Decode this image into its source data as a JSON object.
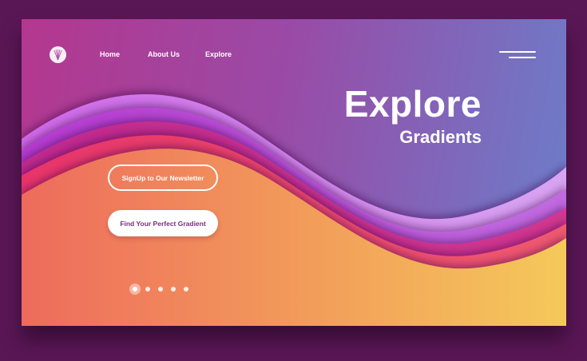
{
  "nav": {
    "items": [
      {
        "label": "Home"
      },
      {
        "label": "About Us"
      },
      {
        "label": "Explore"
      }
    ]
  },
  "hero": {
    "title": "Explore",
    "subtitle": "Gradients"
  },
  "buttons": {
    "newsletter": "SignUp to Our Newsletter",
    "find_gradient": "Find Your Perfect Gradient"
  },
  "carousel": {
    "slide_count": 5,
    "active_index": 0
  },
  "colors": {
    "outer_background": "#5a1756",
    "accent_purple": "#b4378e",
    "accent_blue": "#6a7fcb",
    "accent_orange": "#f07a5e",
    "accent_yellow": "#f4c65a",
    "button_text": "#7a2c7e"
  },
  "icons": {
    "logo": "fan-logo-icon",
    "menu": "hamburger-menu-icon"
  }
}
